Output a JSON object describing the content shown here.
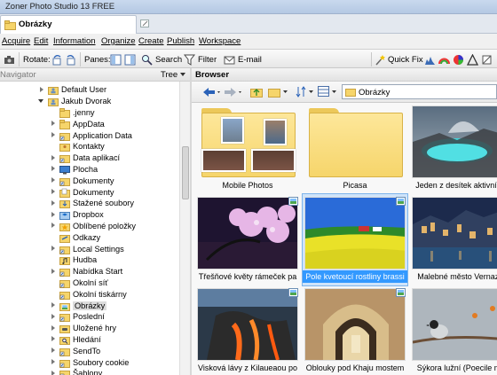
{
  "window": {
    "title": "Zoner Photo Studio 13 FREE"
  },
  "tabs": [
    {
      "label": "Obrázky"
    }
  ],
  "menu": {
    "items": [
      "Acquire",
      "Edit",
      "Information",
      "Organize",
      "Create",
      "Publish",
      "Workspace"
    ]
  },
  "toolbar": {
    "rotate_label": "Rotate:",
    "panes_label": "Panes:",
    "search_label": "Search",
    "filter_label": "Filter",
    "email_label": "E-mail",
    "quickfix_label": "Quick Fix"
  },
  "navigator": {
    "title": "Navigator",
    "view_mode": "Tree",
    "tree": [
      {
        "label": "Default User",
        "expander": "collapsed",
        "depth": 0,
        "icon": "user-folder-icon"
      },
      {
        "label": "Jakub Dvorak",
        "expander": "expanded",
        "depth": 0,
        "icon": "user-folder-icon"
      },
      {
        "label": ".jenny",
        "expander": "none",
        "depth": 1,
        "icon": "folder-icon"
      },
      {
        "label": "AppData",
        "expander": "collapsed",
        "depth": 1,
        "icon": "folder-icon"
      },
      {
        "label": "Application Data",
        "expander": "collapsed",
        "depth": 1,
        "icon": "shortcut-folder-icon"
      },
      {
        "label": "Kontakty",
        "expander": "none",
        "depth": 1,
        "icon": "contacts-folder-icon"
      },
      {
        "label": "Data aplikací",
        "expander": "collapsed",
        "depth": 1,
        "icon": "shortcut-folder-icon"
      },
      {
        "label": "Plocha",
        "expander": "collapsed",
        "depth": 1,
        "icon": "desktop-folder-icon"
      },
      {
        "label": "Dokumenty",
        "expander": "collapsed",
        "depth": 1,
        "icon": "shortcut-folder-icon"
      },
      {
        "label": "Dokumenty",
        "expander": "collapsed",
        "depth": 1,
        "icon": "documents-folder-icon"
      },
      {
        "label": "Stažené soubory",
        "expander": "collapsed",
        "depth": 1,
        "icon": "downloads-folder-icon"
      },
      {
        "label": "Dropbox",
        "expander": "collapsed",
        "depth": 1,
        "icon": "dropbox-folder-icon"
      },
      {
        "label": "Oblíbené položky",
        "expander": "collapsed",
        "depth": 1,
        "icon": "favorites-folder-icon"
      },
      {
        "label": "Odkazy",
        "expander": "none",
        "depth": 1,
        "icon": "links-folder-icon"
      },
      {
        "label": "Local Settings",
        "expander": "collapsed",
        "depth": 1,
        "icon": "shortcut-folder-icon"
      },
      {
        "label": "Hudba",
        "expander": "none",
        "depth": 1,
        "icon": "music-folder-icon"
      },
      {
        "label": "Nabídka Start",
        "expander": "collapsed",
        "depth": 1,
        "icon": "shortcut-folder-icon"
      },
      {
        "label": "Okolní síť",
        "expander": "none",
        "depth": 1,
        "icon": "shortcut-folder-icon"
      },
      {
        "label": "Okolní tiskárny",
        "expander": "none",
        "depth": 1,
        "icon": "shortcut-folder-icon"
      },
      {
        "label": "Obrázky",
        "expander": "collapsed",
        "depth": 1,
        "icon": "pictures-folder-icon",
        "selected": true
      },
      {
        "label": "Poslední",
        "expander": "collapsed",
        "depth": 1,
        "icon": "shortcut-folder-icon"
      },
      {
        "label": "Uložené hry",
        "expander": "collapsed",
        "depth": 1,
        "icon": "games-folder-icon"
      },
      {
        "label": "Hledání",
        "expander": "collapsed",
        "depth": 1,
        "icon": "search-folder-icon"
      },
      {
        "label": "SendTo",
        "expander": "collapsed",
        "depth": 1,
        "icon": "shortcut-folder-icon"
      },
      {
        "label": "Soubory cookie",
        "expander": "collapsed",
        "depth": 1,
        "icon": "shortcut-folder-icon"
      },
      {
        "label": "Šablony",
        "expander": "collapsed",
        "depth": 1,
        "icon": "shortcut-folder-icon"
      }
    ]
  },
  "browser": {
    "title": "Browser",
    "path": "Obrázky",
    "items": [
      {
        "caption": "Mobile Photos",
        "kind": "folder",
        "selected": false
      },
      {
        "caption": "Picasa",
        "kind": "folder",
        "selected": false
      },
      {
        "caption": "Jeden z desítek aktivní vul",
        "kind": "image",
        "scene": "volcano-lake",
        "selected": false
      },
      {
        "caption": "Třešňové květy rámeček pa",
        "kind": "image",
        "scene": "cherry-blossom-night",
        "selected": false
      },
      {
        "caption": "Pole kvetoucí rostliny brassi",
        "kind": "image",
        "scene": "rapeseed-field",
        "selected": true
      },
      {
        "caption": "Malebné město Vernazza",
        "kind": "image",
        "scene": "coastal-town",
        "selected": false
      },
      {
        "caption": "Visková lávy z Kilaueaou po",
        "kind": "image",
        "scene": "lava-flow",
        "selected": false
      },
      {
        "caption": "Oblouky pod Khaju mostem",
        "kind": "image",
        "scene": "bridge-arches",
        "selected": false
      },
      {
        "caption": "Sýkora lužní (Poecile mor",
        "kind": "image",
        "scene": "bird-branch",
        "selected": false
      }
    ]
  }
}
